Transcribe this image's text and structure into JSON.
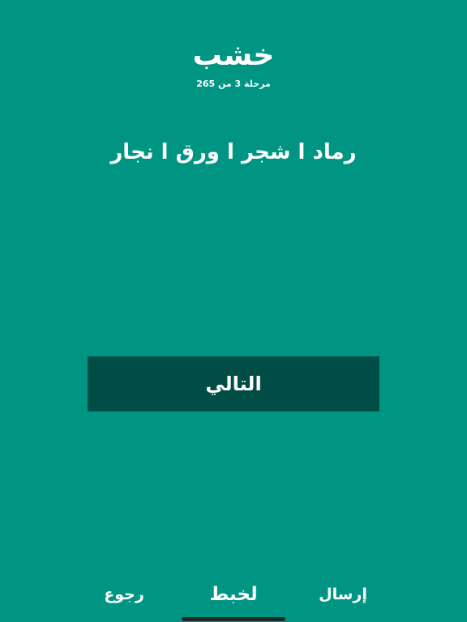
{
  "game": {
    "answer": "خشب",
    "stage_label": "مرحلة 3 من 265",
    "clues_text": "رماد ا شجر ا ورق ا نجار"
  },
  "actions": {
    "next_label": "التالي"
  },
  "bottom_bar": {
    "send_label": "إرسال",
    "shuffle_label": "لخبط",
    "back_label": "رجوع"
  },
  "colors": {
    "background": "#009583",
    "next_button": "#004d45",
    "text": "#ffffff"
  }
}
